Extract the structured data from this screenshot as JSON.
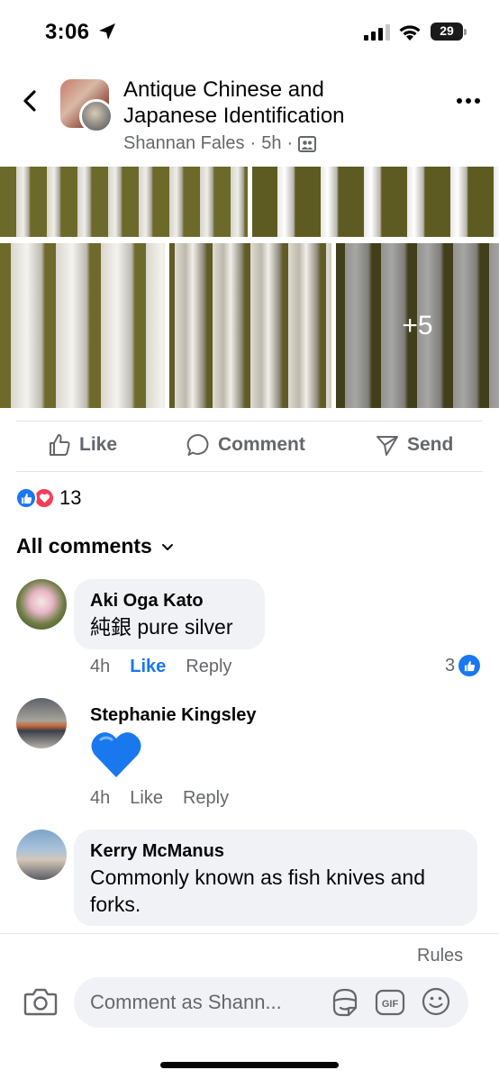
{
  "status_bar": {
    "time": "3:06",
    "battery_level": "29"
  },
  "header": {
    "group_title": "Antique Chinese and Japanese Identification",
    "author": "Shannan Fales",
    "separator": "·",
    "time_ago": "5h",
    "privacy_icon": "group-members-icon"
  },
  "photos": {
    "more_count": "+5"
  },
  "actions": {
    "like": "Like",
    "comment": "Comment",
    "send": "Send"
  },
  "reactions": {
    "count": "13",
    "types": [
      "like",
      "love"
    ]
  },
  "comments_filter": {
    "label": "All comments"
  },
  "comments": [
    {
      "author": "Aki Oga Kato",
      "text": "純銀 pure silver",
      "time": "4h",
      "like_label": "Like",
      "reply_label": "Reply",
      "reaction_count": "3"
    },
    {
      "author": "Stephanie Kingsley",
      "text": "💙",
      "time": "4h",
      "like_label": "Like",
      "reply_label": "Reply"
    },
    {
      "author": "Kerry McManus",
      "text": "Commonly known as fish knives and forks."
    }
  ],
  "composer": {
    "rules_label": "Rules",
    "placeholder": "Comment as Shann..."
  },
  "colors": {
    "accent": "#1877f2",
    "love": "#f33e58",
    "secondary_text": "#65676b",
    "bubble_bg": "#f0f2f5"
  }
}
